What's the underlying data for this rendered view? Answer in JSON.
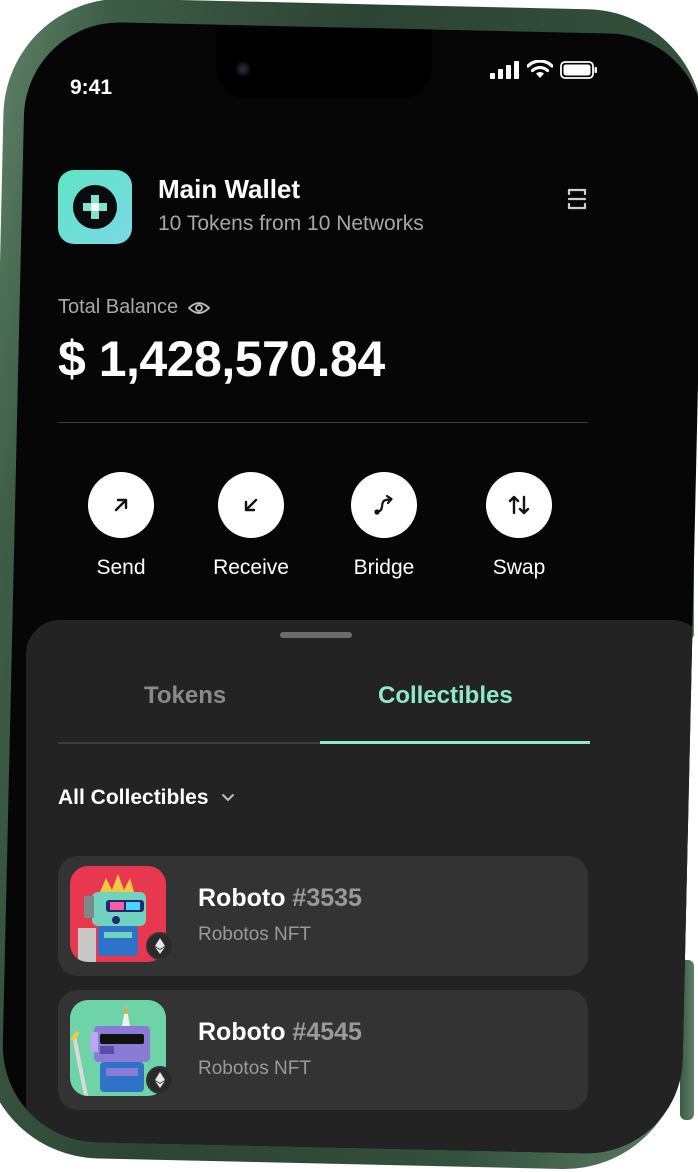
{
  "status_bar": {
    "time": "9:41"
  },
  "wallet": {
    "name": "Main Wallet",
    "subtitle": "10 Tokens from 10 Networks"
  },
  "balance": {
    "label": "Total Balance",
    "value": "$ 1,428,570.84"
  },
  "actions": [
    {
      "label": "Send",
      "icon": "arrow-up-right-icon"
    },
    {
      "label": "Receive",
      "icon": "arrow-down-left-icon"
    },
    {
      "label": "Bridge",
      "icon": "bridge-icon"
    },
    {
      "label": "Swap",
      "icon": "swap-arrows-icon"
    }
  ],
  "tabs": [
    {
      "label": "Tokens",
      "active": false
    },
    {
      "label": "Collectibles",
      "active": true
    }
  ],
  "filter": {
    "label": "All Collectibles"
  },
  "collectibles": [
    {
      "name": "Roboto",
      "number": "#3535",
      "collection": "Robotos NFT",
      "bg": "#e8384f"
    },
    {
      "name": "Roboto",
      "number": "#4545",
      "collection": "Robotos NFT",
      "bg": "#6fd3a8"
    }
  ],
  "colors": {
    "accent": "#8ee9cc",
    "background": "#060606",
    "sheet": "#232323",
    "frame": "#3d5c45"
  }
}
